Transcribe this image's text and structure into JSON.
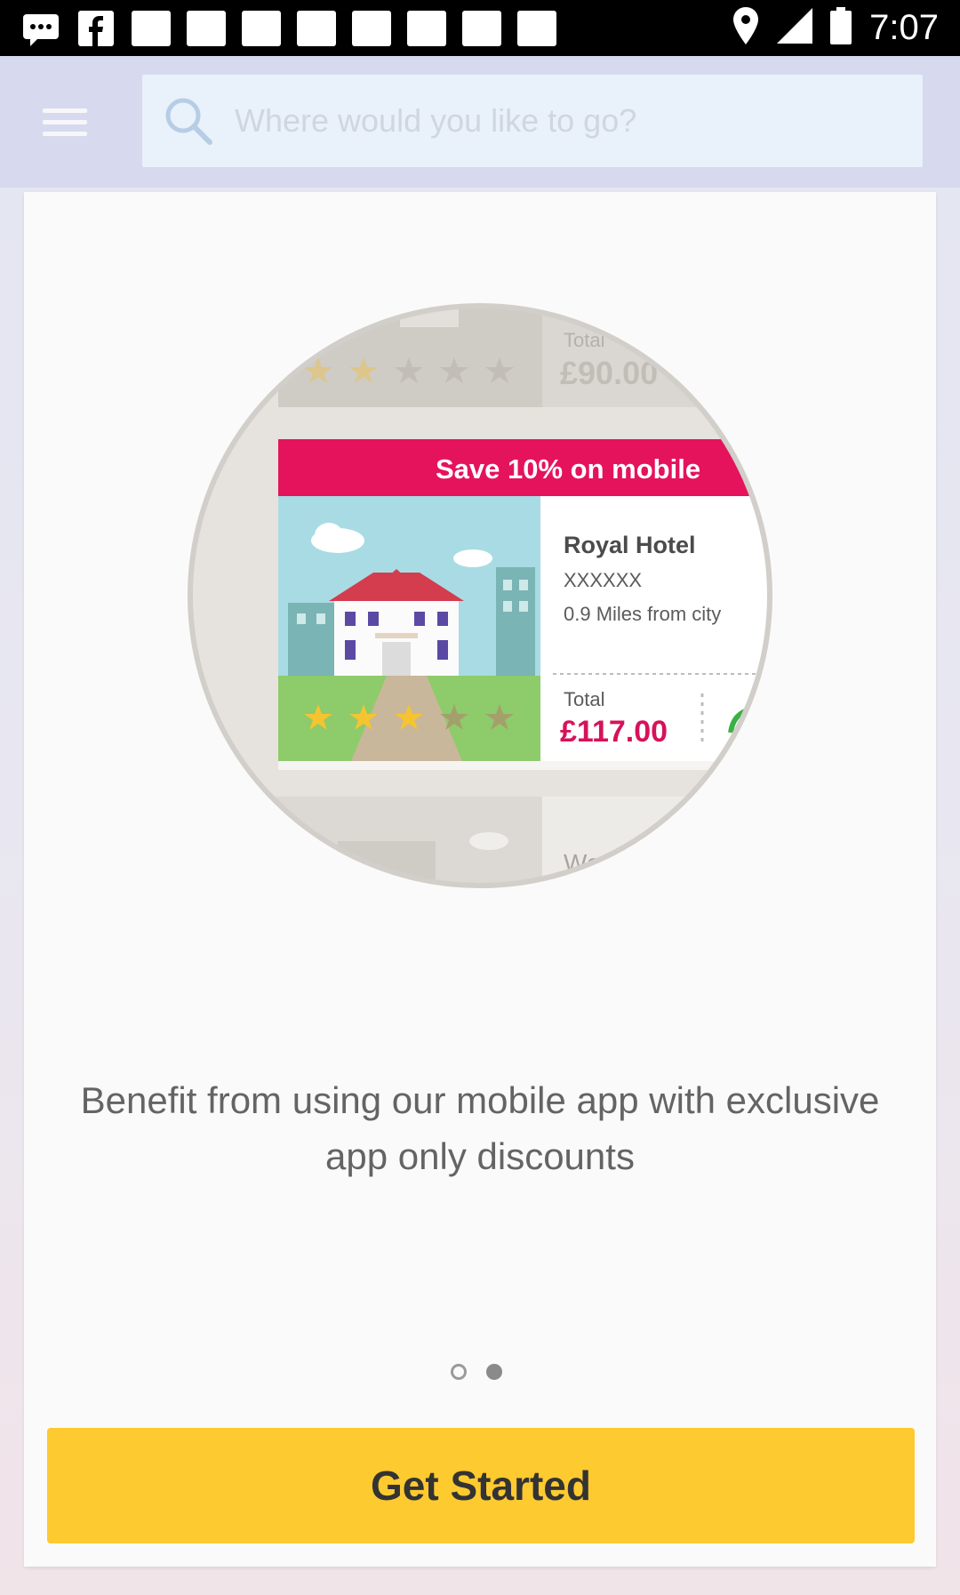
{
  "status_bar": {
    "time": "7:07",
    "notification_icons": [
      "messages-icon",
      "facebook-icon",
      "app-icon",
      "app-icon",
      "app-icon",
      "app-icon",
      "app-icon",
      "app-icon",
      "app-icon",
      "app-icon"
    ],
    "system_icons": [
      "location-icon",
      "signal-icon",
      "battery-icon"
    ]
  },
  "header": {
    "menu_icon": "hamburger-menu-icon",
    "search": {
      "icon": "search-icon",
      "placeholder": "Where would you like to go?",
      "value": ""
    }
  },
  "onboarding": {
    "illustration": {
      "icon": "hotel-listing-illustration",
      "banner": "Save 10% on mobile",
      "hotel_name": "Royal Hotel",
      "hotel_address": "XXXXXX",
      "distance": "0.9 Miles from city",
      "total_label": "Total",
      "total_price": "£117.00",
      "rating_stars": 3,
      "rating_max": 5,
      "prev_card_total_label": "Total",
      "prev_card_total": "£90.00",
      "prev_card_rating_stars": 2,
      "next_card_text": "We"
    },
    "headline": "Benefit from using our mobile app with exclusive app only discounts",
    "pager": {
      "current_page": 2,
      "total_pages": 2
    },
    "cta_label": "Get Started"
  },
  "colors": {
    "app_bar": "#d7d9ee",
    "search_box": "#e9f1fb",
    "cta_background": "#fdca2f",
    "banner": "#e5135c",
    "price": "#d6125a"
  }
}
